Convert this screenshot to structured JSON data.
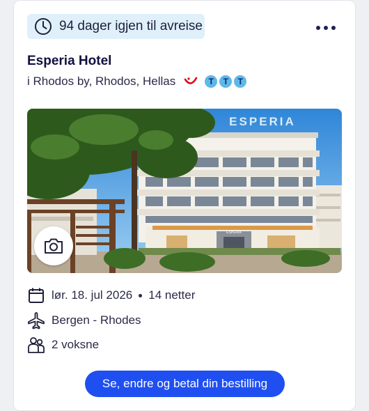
{
  "countdown": {
    "text": "94 dager igjen til avreise",
    "icon": "clock-icon"
  },
  "menu": {
    "icon": "more-icon"
  },
  "hotel": {
    "name": "Esperia Hotel",
    "location": "i Rhodos by, Rhodos, Hellas",
    "brand_icon": "tui-logo",
    "rating_letters": [
      "T",
      "T",
      "T"
    ],
    "rating": 3,
    "image_sign_text": "ESPERIA",
    "image_entrance_text": "ESPERIA"
  },
  "camera": {
    "icon": "camera-icon"
  },
  "trip": {
    "date": "lør. 18. jul 2026",
    "nights": "14 netter",
    "route": "Bergen - Rhodes",
    "travellers": "2 voksne"
  },
  "actions": {
    "manage_label": "Se, endre og betal din bestilling"
  },
  "colors": {
    "accent": "#1f4ff0",
    "badge_bg": "#dff0fb",
    "heading": "#101040",
    "rating": "#5fb8e8",
    "tui_red": "#e2001a"
  }
}
